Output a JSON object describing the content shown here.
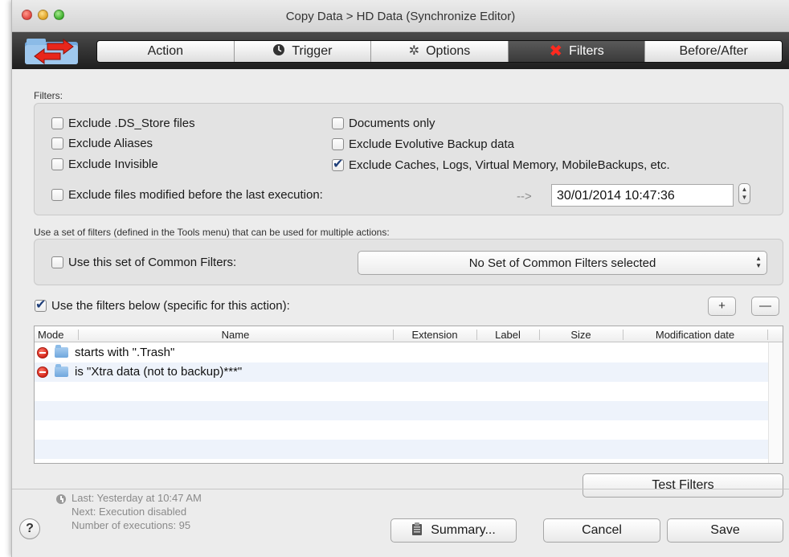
{
  "window": {
    "title": "Copy Data > HD Data (Synchronize Editor)"
  },
  "tabs": [
    {
      "label": "Action",
      "icon": "",
      "active": false
    },
    {
      "label": "Trigger",
      "icon": "clock-icon",
      "active": false
    },
    {
      "label": "Options",
      "icon": "gear-icon",
      "active": false
    },
    {
      "label": "Filters",
      "icon": "red-x-icon",
      "active": true
    },
    {
      "label": "Before/After",
      "icon": "",
      "active": false
    }
  ],
  "filters": {
    "section_label": "Filters:",
    "exclude_ds_store": {
      "label": "Exclude .DS_Store files",
      "checked": false
    },
    "exclude_aliases": {
      "label": "Exclude Aliases",
      "checked": false
    },
    "exclude_invisible": {
      "label": "Exclude Invisible",
      "checked": false
    },
    "documents_only": {
      "label": "Documents only",
      "checked": false
    },
    "exclude_evolutive": {
      "label": "Exclude Evolutive Backup data",
      "checked": false
    },
    "exclude_caches": {
      "label": "Exclude Caches, Logs, Virtual Memory, MobileBackups, etc.",
      "checked": true
    },
    "exclude_modified": {
      "label": "Exclude files modified before the last execution:",
      "checked": false
    },
    "arrow": "-->",
    "date_value": "30/01/2014 10:47:36"
  },
  "common": {
    "section_label": "Use a set of filters (defined in the Tools menu) that can be used for multiple actions:",
    "use_set": {
      "label": "Use this set of Common Filters:",
      "checked": false
    },
    "popup_value": "No Set of Common Filters selected"
  },
  "specific": {
    "use_below": {
      "label": "Use the filters below (specific for this action):",
      "checked": true
    },
    "add_label": "+",
    "remove_label": "—"
  },
  "table": {
    "columns": [
      "Mode",
      "Name",
      "Extension",
      "Label",
      "Size",
      "Modification date"
    ],
    "rows": [
      {
        "mode_icon": "remove-circle-icon",
        "kind_icon": "folder-icon",
        "name": "starts with \".Trash\""
      },
      {
        "mode_icon": "remove-circle-icon",
        "kind_icon": "folder-icon",
        "name": "is \"Xtra data (not to backup)***\""
      }
    ]
  },
  "buttons": {
    "test_filters": "Test Filters",
    "summary": "Summary...",
    "cancel": "Cancel",
    "save": "Save",
    "help": "?"
  },
  "status": {
    "last": "Last: Yesterday at 10:47 AM",
    "next": "Next: Execution disabled",
    "count": "Number of executions: 95"
  }
}
